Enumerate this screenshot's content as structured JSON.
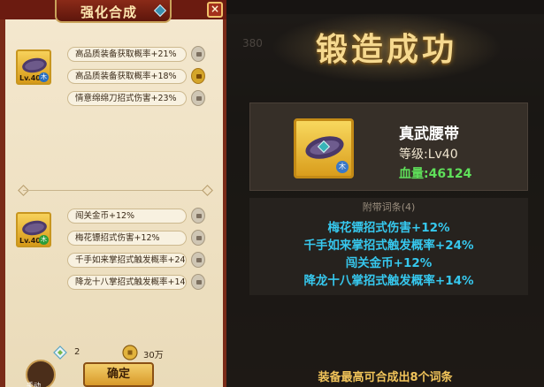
{
  "left_panel": {
    "title": "强化合成",
    "close_glyph": "×",
    "item_top": {
      "level": "Lv.40",
      "badge": "木",
      "badge_color": "#2a6fc0",
      "attrs": [
        {
          "text": "高品质装备获取概率+21%",
          "lock": "gray"
        },
        {
          "text": "高品质装备获取概率+18%",
          "lock": "gold"
        },
        {
          "text": "情意绵绵刀招式伤害+23%",
          "lock": "gray"
        }
      ]
    },
    "item_bottom": {
      "level": "Lv.40",
      "badge": "木",
      "badge_color": "#2a9d3a",
      "attrs": [
        {
          "text": "闯关金币+12%",
          "lock": "gray"
        },
        {
          "text": "梅花镖招式伤害+12%",
          "lock": "gray"
        },
        {
          "text": "千手如来掌招式触发概率+24",
          "lock": "gray"
        },
        {
          "text": "降龙十八掌招式触发概率+14",
          "lock": "gray"
        }
      ]
    },
    "resources": {
      "scroll_count": "2",
      "coin_label": "30万"
    },
    "confirm_label": "确定",
    "manual_label": "手动"
  },
  "right_panel": {
    "banner": "锻造成功",
    "ghost_number": "380",
    "item": {
      "name": "真武腰带",
      "level_text": "等级:Lv40",
      "hp_text": "血量:46124",
      "badge": "木"
    },
    "attr_header": "附带词条(4)",
    "attr_lines": [
      "梅花镖招式伤害+12%",
      "千手如来掌招式触发概率+24%",
      "闯关金币+12%",
      "降龙十八掌招式触发概率+14%"
    ],
    "footer": "装备最高可合成出8个词条"
  },
  "colors": {
    "accent_gold": "#f6d98f",
    "attr_blue": "#36c8ee",
    "hp_green": "#5fe05a",
    "footer_gold": "#f1c45a"
  }
}
